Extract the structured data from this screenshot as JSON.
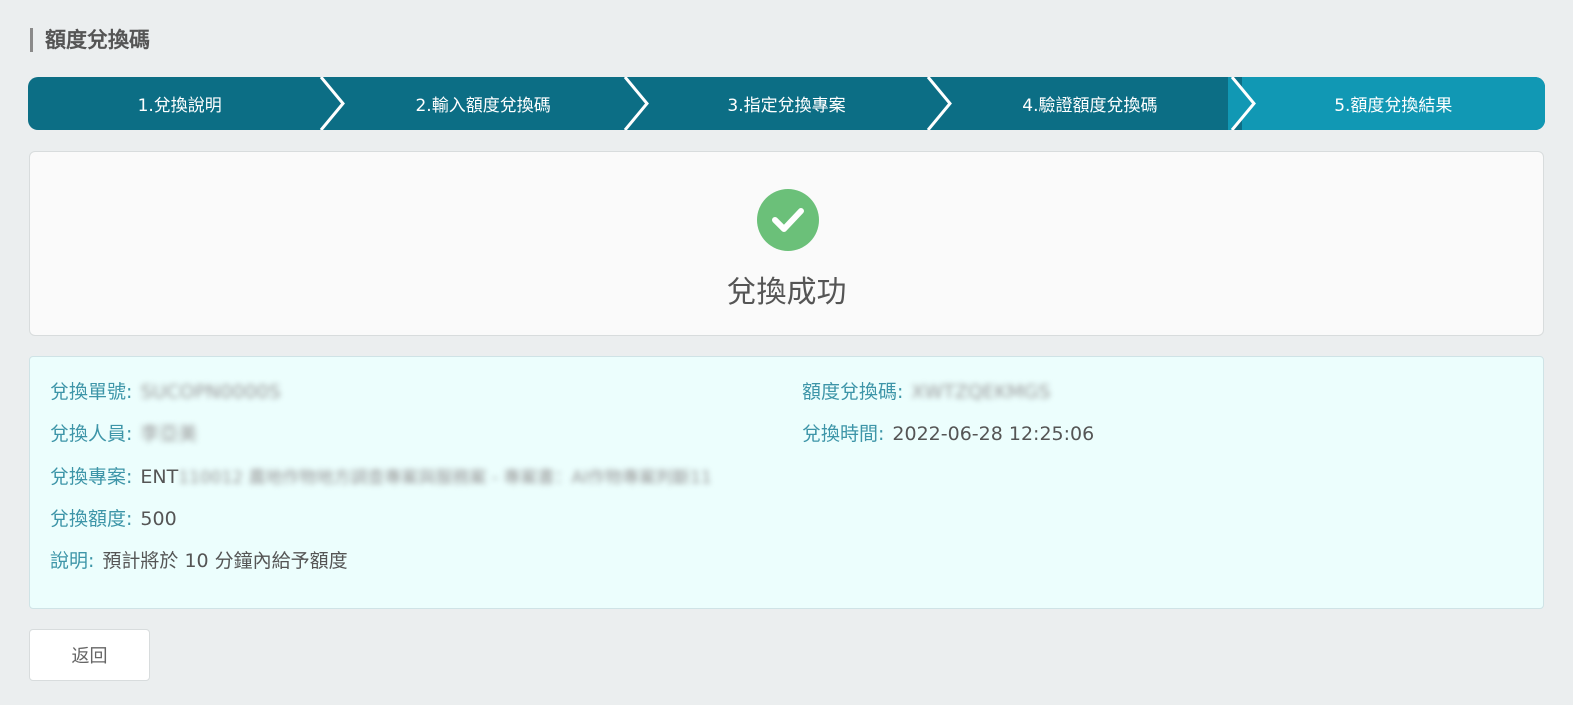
{
  "page": {
    "title": "額度兌換碼"
  },
  "steps": [
    {
      "label": "1.兌換說明",
      "active": false
    },
    {
      "label": "2.輸入額度兌換碼",
      "active": false
    },
    {
      "label": "3.指定兌換專案",
      "active": false
    },
    {
      "label": "4.驗證額度兌換碼",
      "active": false
    },
    {
      "label": "5.額度兌換結果",
      "active": true
    }
  ],
  "result": {
    "icon": "check-circle-icon",
    "message": "兌換成功",
    "color": "#6bc079"
  },
  "details": {
    "order_no": {
      "label": "兌換單號:",
      "value": "SUCOPN0000S"
    },
    "redeem_code": {
      "label": "額度兌換碼:",
      "value": "XWTZQEKMGS"
    },
    "operator": {
      "label": "兌換人員:",
      "value": "李亞美"
    },
    "redeem_time": {
      "label": "兌換時間:",
      "value": "2022-06-28 12:25:06"
    },
    "project": {
      "label": "兌換專案:",
      "value_prefix": "ENT",
      "value_blurred": "110012 農地作物地方調查專案與服務案 - 專案書：AI作物專案判斷11"
    },
    "amount": {
      "label": "兌換額度:",
      "value": "500"
    },
    "note": {
      "label": "說明:",
      "value": "預計將於 10 分鐘內給予額度"
    }
  },
  "actions": {
    "back_label": "返回"
  },
  "colors": {
    "step_bg": "#0c6e85",
    "step_active": "#1198b4",
    "info_bg": "#ecfefd",
    "label": "#3d95a8"
  }
}
